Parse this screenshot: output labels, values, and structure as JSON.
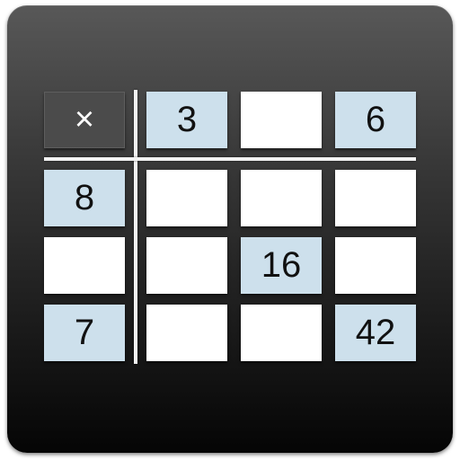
{
  "app_icon": {
    "name": "multiplication-table-puzzle",
    "colors": {
      "background_top": "#585858",
      "background_bottom": "#050505",
      "header_cell": "#cde0ec",
      "blank_cell": "#ffffff",
      "operator_cell": "#4b4b4b",
      "divider": "#f2f2f2"
    }
  },
  "grid": {
    "operator": "×",
    "column_headers": [
      "3",
      "",
      "6"
    ],
    "row_headers": [
      "8",
      "",
      "7"
    ],
    "body": [
      [
        "",
        "",
        ""
      ],
      [
        "",
        "16",
        ""
      ],
      [
        "",
        "",
        "42"
      ]
    ],
    "header_cells": [
      "r0c1",
      "r0c3",
      "r1c0",
      "r2c2",
      "r3c0",
      "r3c3"
    ]
  }
}
